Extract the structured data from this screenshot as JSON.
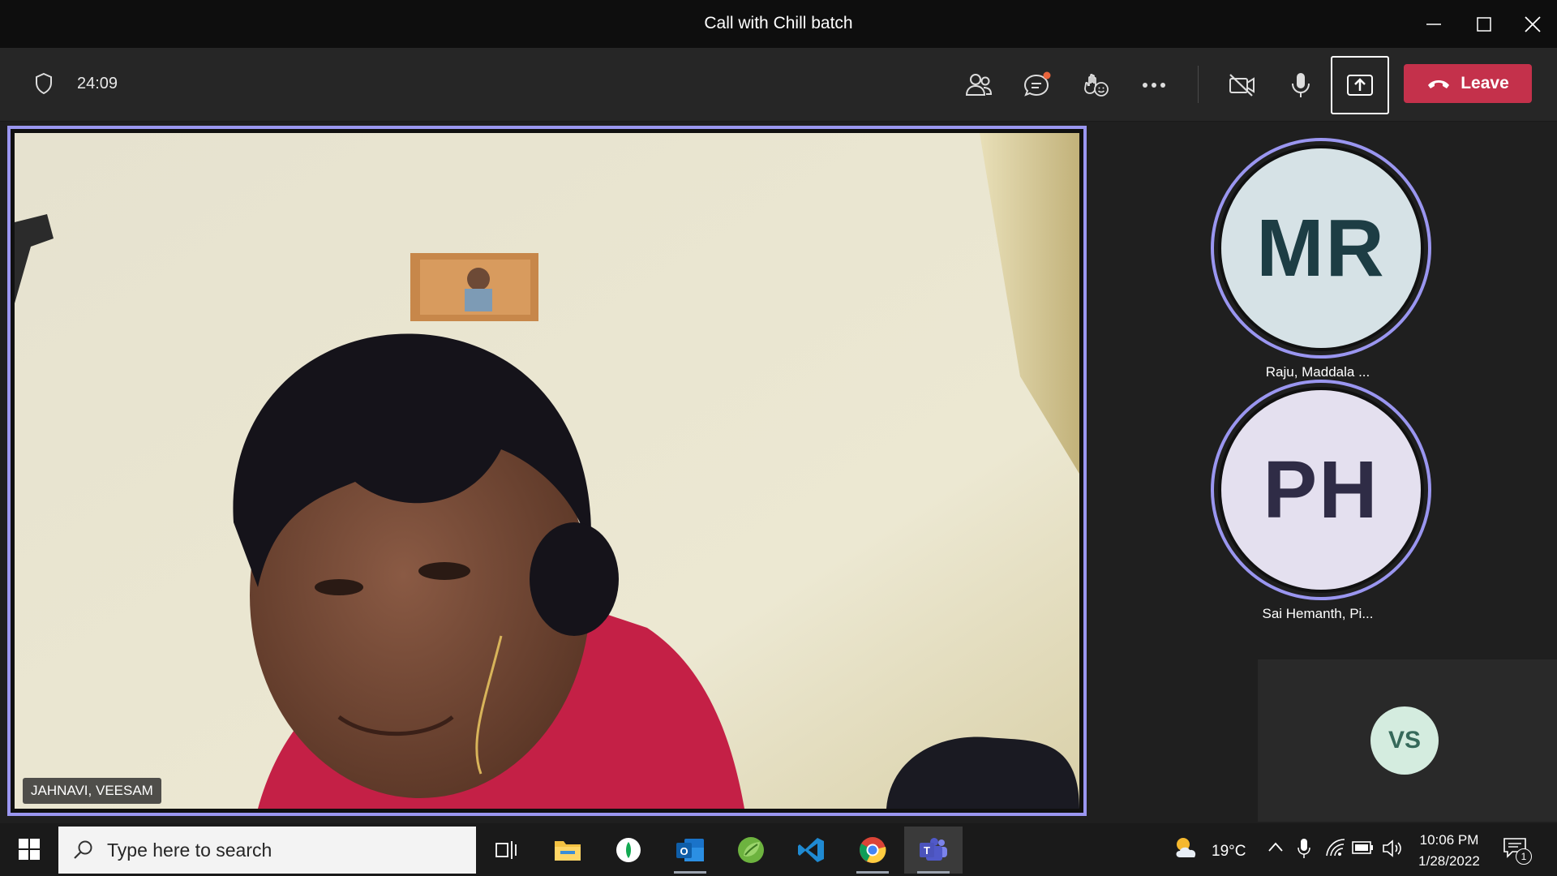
{
  "window": {
    "title": "Call with Chill batch"
  },
  "toolbar": {
    "timer": "24:09",
    "leave_label": "Leave",
    "colors": {
      "leave": "#c4314b",
      "accent": "#9a96f0"
    }
  },
  "main_video": {
    "participant_name": "JAHNAVI, VEESAM"
  },
  "participants": [
    {
      "initials": "MR",
      "name": "Raju, Maddala ...",
      "bg": "#d6e2e6",
      "fg": "#1d3d44"
    },
    {
      "initials": "PH",
      "name": "Sai Hemanth, Pi...",
      "bg": "#e4e0ef",
      "fg": "#2f2c46"
    },
    {
      "initials": "VS"
    }
  ],
  "taskbar": {
    "search_placeholder": "Type here to search",
    "weather": "19°C",
    "time": "10:06 PM",
    "date": "1/28/2022",
    "notifications": "1"
  },
  "icons": [
    "shield-icon",
    "people-icon",
    "chat-icon",
    "reactions-icon",
    "more-icon",
    "camera-off-icon",
    "microphone-icon",
    "share-icon",
    "phone-icon",
    "windows-logo-icon",
    "search-icon",
    "task-view-icon",
    "file-explorer-icon",
    "app-circle-icon",
    "outlook-icon",
    "spring-icon",
    "vscode-icon",
    "chrome-icon",
    "teams-icon",
    "weather-icon",
    "chevron-up-icon",
    "mic-tray-icon",
    "wifi-icon",
    "battery-icon",
    "volume-icon",
    "notification-icon"
  ]
}
